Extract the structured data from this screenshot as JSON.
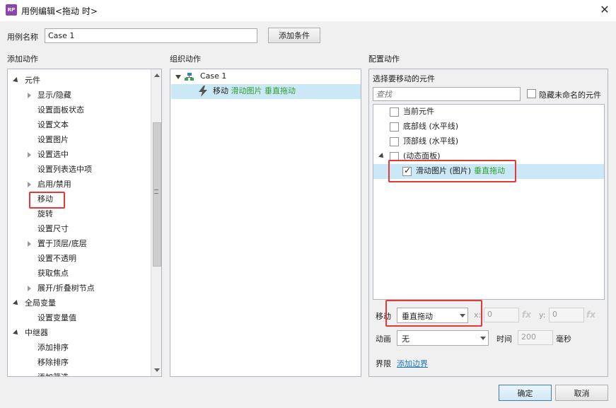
{
  "window": {
    "app_icon_text": "RP",
    "title": "用例编辑<拖动 时>",
    "close_glyph": "✕"
  },
  "case_name": {
    "label": "用例名称",
    "value": "Case 1",
    "add_condition_label": "添加条件"
  },
  "add_actions": {
    "header": "添加动作",
    "tree": [
      {
        "label": "元件",
        "level": 0,
        "expanded": true
      },
      {
        "label": "显示/隐藏",
        "level": 1,
        "expandable": true
      },
      {
        "label": "设置面板状态",
        "level": 1
      },
      {
        "label": "设置文本",
        "level": 1
      },
      {
        "label": "设置图片",
        "level": 1
      },
      {
        "label": "设置选中",
        "level": 1,
        "expandable": true
      },
      {
        "label": "设置列表选中项",
        "level": 1
      },
      {
        "label": "启用/禁用",
        "level": 1,
        "expandable": true
      },
      {
        "label": "移动",
        "level": 1,
        "highlighted": true
      },
      {
        "label": "旋转",
        "level": 1
      },
      {
        "label": "设置尺寸",
        "level": 1
      },
      {
        "label": "置于顶层/底层",
        "level": 1,
        "expandable": true
      },
      {
        "label": "设置不透明",
        "level": 1
      },
      {
        "label": "获取焦点",
        "level": 1
      },
      {
        "label": "展开/折叠树节点",
        "level": 1,
        "expandable": true
      },
      {
        "label": "全局变量",
        "level": 0,
        "expanded": true
      },
      {
        "label": "设置变量值",
        "level": 1
      },
      {
        "label": "中继器",
        "level": 0,
        "expanded": true
      },
      {
        "label": "添加排序",
        "level": 1
      },
      {
        "label": "移除排序",
        "level": 1
      },
      {
        "label": "添加筛选",
        "level": 1
      }
    ]
  },
  "organize_actions": {
    "header": "组织动作",
    "case_label": "Case 1",
    "action": {
      "verb": "移动",
      "target": "滑动图片",
      "mode": "垂直拖动"
    }
  },
  "configure_actions": {
    "header": "配置动作",
    "select_widget_label": "选择要移动的元件",
    "search_placeholder": "查找",
    "hide_unnamed_label": "隐藏未命名的元件",
    "widgets": [
      {
        "label": "当前元件",
        "checked": false,
        "level": 0
      },
      {
        "label": "底部线 (水平线)",
        "checked": false,
        "level": 0
      },
      {
        "label": "顶部线 (水平线)",
        "checked": false,
        "level": 0
      },
      {
        "label": "(动态面板)",
        "checked": false,
        "level": 0,
        "expanded": true
      },
      {
        "label": "滑动图片 (图片)",
        "suffix": "垂直拖动",
        "checked": true,
        "level": 1,
        "selected": true
      }
    ],
    "move": {
      "label": "移动",
      "value": "垂直拖动",
      "x_label": "x:",
      "x_value": "0",
      "y_label": "y:",
      "y_value": "0",
      "fx_label": "fx"
    },
    "animate": {
      "label": "动画",
      "value": "无",
      "time_label": "时间",
      "time_value": "200",
      "unit": "毫秒"
    },
    "bounds": {
      "label": "界限",
      "link": "添加边界"
    }
  },
  "footer": {
    "ok_label": "确定",
    "cancel_label": "取消"
  },
  "colors": {
    "highlight": "#cbe8f6",
    "red_annotation": "#e53935",
    "green_text": "#2e9e2e",
    "link": "#1a73c7"
  }
}
